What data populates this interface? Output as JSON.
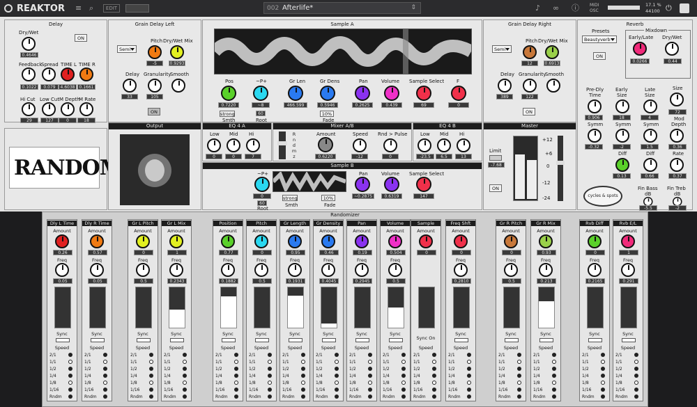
{
  "app": {
    "name": "REAKTOR",
    "edit": "EDIT",
    "snapshot_no": "002",
    "snapshot_name": "Afterlife*",
    "midi": "MIDI",
    "osc": "OSC",
    "cpu": "17.1 %",
    "sr": "44100"
  },
  "colors": {
    "red": "#e02020",
    "orange": "#f07a12",
    "yellow": "#e2f020",
    "green": "#5ad02a",
    "cyan": "#2ad8f0",
    "blue": "#2a7af0",
    "purple": "#8a32f0",
    "magenta": "#f030c8",
    "crimson": "#f0304a",
    "brown": "#c8783a",
    "olive": "#9ad04a",
    "pink": "#f02a7a"
  },
  "delay": {
    "title": "Delay",
    "drywet": "Dry/Wet",
    "drywet_v": "0.4646",
    "on": "ON",
    "feedback": "Feedback",
    "feedback_v": "0.1022",
    "spread": "Spread",
    "spread_v": "0.079",
    "timel": "TIME L",
    "timel_v": "4.6038",
    "timer": "TIME R",
    "timer_v": "0.1661",
    "hicut": "Hi Cut",
    "hicut_v": "29",
    "locut": "Low Cut",
    "locut_v": "127",
    "mdepth": "M Depth",
    "mdepth_v": "0",
    "mrate": "M Rate",
    "mrate_v": "18"
  },
  "output": {
    "title": "Output",
    "logo": "RANDOM"
  },
  "gdl": {
    "title": "Grain Delay Left",
    "semi": "Semi",
    "pitch": "Pitch",
    "pitch_v": "-5",
    "mix": "Dry/Wet Mix",
    "mix_v": "0.9293",
    "delay": "Delay",
    "delay_v": "33",
    "gran": "Granularity",
    "gran_v": "105",
    "smooth": "Smooth",
    "on": "ON"
  },
  "gdr": {
    "title": "Grain Delay Right",
    "semi": "Semi",
    "pitch": "Pitch",
    "pitch_v": "12",
    "mix": "Dry/Wet Mix",
    "mix_v": "0.6913",
    "delay": "Delay",
    "delay_v": "389",
    "gran": "Granularity",
    "gran_v": "122",
    "smooth": "Smooth",
    "on": "ON"
  },
  "sa": {
    "title": "Sample A",
    "pos": "Pos",
    "pos_v": "0.7220",
    "p": "~P+",
    "p_v": "~8",
    "grlen": "Gr Len",
    "grlen_v": "466.599",
    "grdens": "Gr Dens",
    "grdens_v": "0.5946",
    "pan": "Pan",
    "pan_v": "0.2625",
    "vol": "Volume",
    "vol_v": "0.439",
    "ss": "Sample Select",
    "ss_v": "69",
    "f": "F",
    "f_v": "0",
    "strong": "strong",
    "smth": "Smth",
    "root_v": "60",
    "root": "Root",
    "pct": "10%",
    "fade": "Fade"
  },
  "eqa": {
    "title": "EQ 4 A",
    "low": "Low",
    "low_v": "0",
    "mid": "Mid",
    "mid_v": "0",
    "hi": "Hi",
    "hi_v": "7"
  },
  "mixer": {
    "title": "Mixer A/B",
    "rndmz": [
      "R",
      "n",
      "d",
      "m",
      "z"
    ],
    "amount": "Amount",
    "amount_v": "0.6220",
    "speed": "Speed",
    "speed_v": "-12",
    "rnd": "Rnd > Pulse",
    "rnd_v": "0"
  },
  "eqb": {
    "title": "EQ 4 B",
    "low": "Low",
    "low_v": "-23.5",
    "mid": "Mid",
    "mid_v": "6.5",
    "hi": "Hi",
    "hi_v": "13"
  },
  "sb": {
    "title": "Sample B",
    "p": "~P+",
    "p_v": "0",
    "root_v": "60",
    "root": "Root",
    "strong": "strong",
    "smth": "Smth",
    "pct": "10%",
    "fade": "Fade",
    "pan": "Pan",
    "pan_v": "~0.2875",
    "vol": "Volume",
    "vol_v": "0.6319",
    "ss": "Sample Select",
    "ss_v": "147"
  },
  "master": {
    "title": "Master",
    "limit": "Limit",
    "limit_v": "-7.68",
    "on": "ON",
    "scale": [
      "+12",
      "+6",
      "0",
      "-12",
      "-24"
    ]
  },
  "reverb": {
    "title": "Reverb",
    "presets": "Presets",
    "preset_v": "Beautyverb",
    "on": "ON",
    "mixdown": "Mixdown",
    "el": "Early/Late",
    "el_v": "0.0266",
    "dw": "Dry/Wet",
    "dw_v": "0.44",
    "predly": "Pre-Dly",
    "time": "Time",
    "time_v": "0.906",
    "early": "Early",
    "size": "Size",
    "esize_v": "18",
    "late": "Late",
    "lsize_v": "4",
    "size2_v": "72",
    "symm": "Symm",
    "symm1_v": "-0.32",
    "symm2_v": "-2",
    "symm3_v": "1.5",
    "mod": "Mod",
    "depth": "Depth",
    "depth_v": "0.36",
    "diff": "Diff",
    "diff1_v": "0.13",
    "diff2_v": "0.66",
    "rate": "Rate",
    "rate_v": "0.37",
    "finbass": "Fin Bass",
    "db": "dB",
    "finbass_v": "-5.5",
    "fintreb": "Fin Treb",
    "fintreb_v": "-2",
    "badge": "cycles & spots"
  },
  "rz": {
    "title": "Randomizer",
    "amount": "Amount",
    "freq": "Freq",
    "sync": "Sync",
    "speed": "Speed",
    "synco": "Sync On",
    "rates": [
      "2/1",
      "1/1",
      "1/2",
      "1/4",
      "1/8",
      "1/16",
      "Rndm"
    ],
    "cols": [
      {
        "name": "Dly L Time",
        "a": "0.26",
        "f": "0.05",
        "c": "red",
        "fill": 0
      },
      {
        "name": "Dly R Time",
        "a": "0.57",
        "f": "0.05",
        "c": "orange",
        "fill": 0
      },
      {
        "name": "Gr L Pitch",
        "a": "0",
        "f": "0.5",
        "c": "yellow",
        "fill": 0
      },
      {
        "name": "Gr L Mix",
        "a": "1",
        "f": "0.2343",
        "c": "yellow",
        "fill": 0.45
      },
      {
        "name": "Position",
        "a": "0.77",
        "f": "0.1882",
        "c": "green",
        "fill": 0.77
      },
      {
        "name": "Pitch",
        "a": "0",
        "f": "0.5",
        "c": "cyan",
        "fill": 0
      },
      {
        "name": "Gr Length",
        "a": "0.95",
        "f": "0.1931",
        "c": "blue",
        "fill": 0.8
      },
      {
        "name": "Gr Density",
        "a": "0.46",
        "f": "0.4045",
        "c": "blue",
        "fill": 0.1
      },
      {
        "name": "Pan",
        "a": "0.19",
        "f": "0.2945",
        "c": "purple",
        "fill": 0
      },
      {
        "name": "Volume",
        "a": "0.504",
        "f": "0.5",
        "c": "magenta",
        "fill": 0.5
      },
      {
        "name": "Sample",
        "a": "0",
        "f": "",
        "c": "crimson",
        "fill": 0
      },
      {
        "name": "Freq Shft",
        "a": "0",
        "f": "0.2810",
        "c": "crimson",
        "fill": 0
      },
      {
        "name": "Gr R Pitch",
        "a": "0",
        "f": "0.5",
        "c": "brown",
        "fill": 0
      },
      {
        "name": "Gr R Mix",
        "a": "0.93",
        "f": "0.213",
        "c": "olive",
        "fill": 0.65
      },
      {
        "name": "Rvb Diff",
        "a": "0",
        "f": "0.2165",
        "c": "green",
        "fill": 0
      },
      {
        "name": "Rvb E/L",
        "a": "1",
        "f": "0.291",
        "c": "pink",
        "fill": 0
      }
    ]
  }
}
